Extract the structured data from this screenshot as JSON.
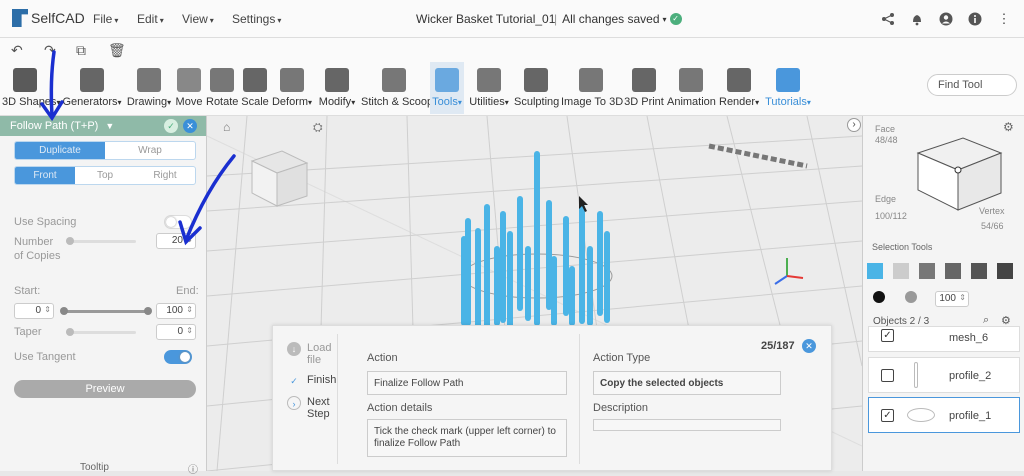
{
  "app": {
    "name": "SelfCAD",
    "document_title": "Wicker Basket Tutorial_01",
    "save_status": "All changes saved"
  },
  "menu": [
    "File",
    "Edit",
    "View",
    "Settings"
  ],
  "toolbar": {
    "tools": [
      {
        "label": "3D Shapes",
        "color": "#5a5a5a"
      },
      {
        "label": "Generators",
        "color": "#666"
      },
      {
        "label": "Drawing",
        "color": "#777"
      },
      {
        "label": "Move",
        "color": "#888"
      },
      {
        "label": "Rotate",
        "color": "#777"
      },
      {
        "label": "Scale",
        "color": "#666"
      },
      {
        "label": "Deform",
        "color": "#777"
      },
      {
        "label": "Modify",
        "color": "#666"
      },
      {
        "label": "Stitch & Scoop",
        "color": "#777"
      },
      {
        "label": "Tools",
        "color": "#6aa9e0"
      },
      {
        "label": "Utilities",
        "color": "#777"
      },
      {
        "label": "Sculpting",
        "color": "#666"
      },
      {
        "label": "Image To 3D",
        "color": "#777"
      },
      {
        "label": "3D Print",
        "color": "#666"
      },
      {
        "label": "Animation",
        "color": "#777"
      },
      {
        "label": "Render",
        "color": "#666"
      },
      {
        "label": "Tutorials",
        "color": "#4a97dc"
      }
    ],
    "find_tool_placeholder": "Find Tool"
  },
  "follow_path": {
    "title": "Follow Path (T+P)",
    "mode_options": [
      "Duplicate",
      "Wrap"
    ],
    "mode_selected": "Duplicate",
    "view_options": [
      "Front",
      "Top",
      "Right"
    ],
    "view_selected": "Front",
    "use_spacing_label": "Use Spacing",
    "use_spacing_on": false,
    "copies_label_1": "Number",
    "copies_label_2": "of Copies",
    "copies_value": "20",
    "start_label": "Start:",
    "end_label": "End:",
    "start_value": "0",
    "end_value": "100",
    "taper_label": "Taper",
    "taper_value": "0",
    "use_tangent_label": "Use Tangent",
    "use_tangent_on": true,
    "preview_label": "Preview",
    "tooltip_label": "Tooltip"
  },
  "right_panel": {
    "face_label": "Face",
    "face_count": "48/48",
    "edge_label": "Edge",
    "edge_count": "100/112",
    "vertex_label": "Vertex",
    "vertex_count": "54/66",
    "selection_tools_label": "Selection Tools",
    "selection_size": "100",
    "objects_label": "Objects 2 / 3",
    "objects": [
      {
        "name": "mesh_6",
        "checked": true,
        "selected": false
      },
      {
        "name": "profile_2",
        "checked": false,
        "selected": false
      },
      {
        "name": "profile_1",
        "checked": true,
        "selected": true
      }
    ]
  },
  "tutorial": {
    "progress": "25/187",
    "steps": [
      {
        "label": "Load file"
      },
      {
        "label": "Finish"
      },
      {
        "label": "Next Step"
      }
    ],
    "action_label": "Action",
    "action_value": "Finalize Follow Path",
    "action_details_label": "Action details",
    "action_details_value": "Tick the check mark (upper left corner) to finalize Follow Path",
    "action_type_label": "Action Type",
    "action_type_value": "Copy the selected objects",
    "description_label": "Description"
  },
  "colors": {
    "accent": "#4a97dc",
    "panel_header": "#8fbaa8",
    "rods": "#4ab4e6",
    "annotation": "#1a2fd0"
  }
}
